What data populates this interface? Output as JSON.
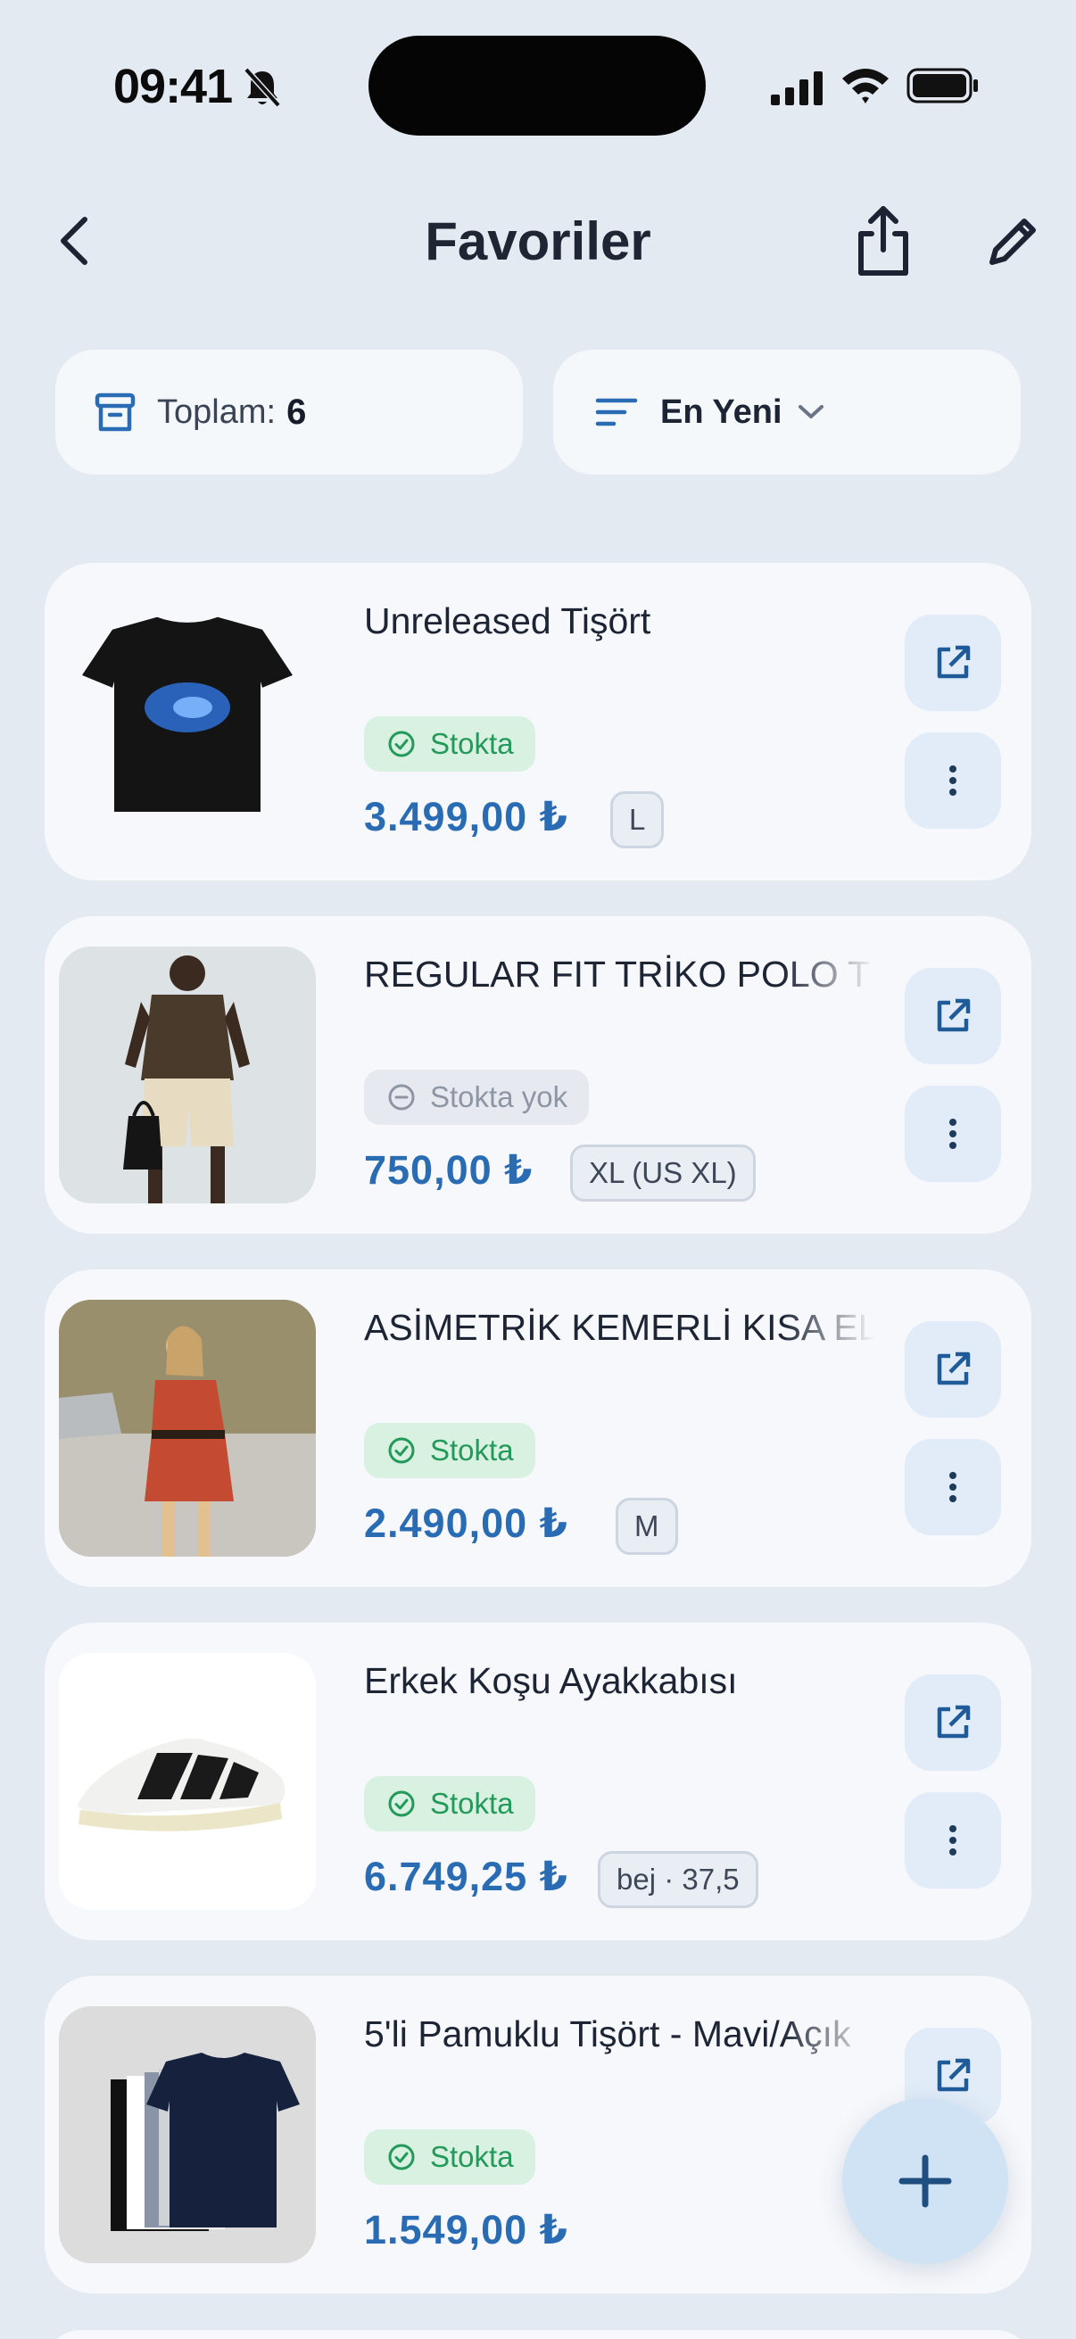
{
  "status_bar": {
    "time": "09:41"
  },
  "header": {
    "title": "Favoriler"
  },
  "filters": {
    "total_label": "Toplam:",
    "total_count": "6",
    "sort_label": "En Yeni"
  },
  "items": [
    {
      "name": "Unreleased Tişört",
      "stock": "Stokta",
      "in_stock": true,
      "price": "3.499,00 ₺",
      "variant": "L",
      "thumb_icon": "black-tshirt-image"
    },
    {
      "name": "REGULAR FIT TRİKO POLO TİŞÖRT",
      "stock": "Stokta yok",
      "in_stock": false,
      "price": "750,00 ₺",
      "variant": "XL (US XL)",
      "thumb_icon": "polo-model-image"
    },
    {
      "name": "ASİMETRİK KEMERLİ KISA ELBİSE",
      "stock": "Stokta",
      "in_stock": true,
      "price": "2.490,00 ₺",
      "variant": "M",
      "thumb_icon": "red-dress-model-image"
    },
    {
      "name": "Erkek Koşu Ayakkabısı",
      "stock": "Stokta",
      "in_stock": true,
      "price": "6.749,25 ₺",
      "variant": "bej · 37,5",
      "thumb_icon": "running-shoe-image"
    },
    {
      "name": "5'li Pamuklu Tişört - Mavi/Açık",
      "stock": "Stokta",
      "in_stock": true,
      "price": "1.549,00 ₺",
      "variant": "",
      "thumb_icon": "tshirt-pack-image"
    }
  ],
  "colors": {
    "accent": "#2a6cb3",
    "in_stock": "#23995a",
    "out_stock": "#8e96a3",
    "background": "#e4eaf2"
  }
}
